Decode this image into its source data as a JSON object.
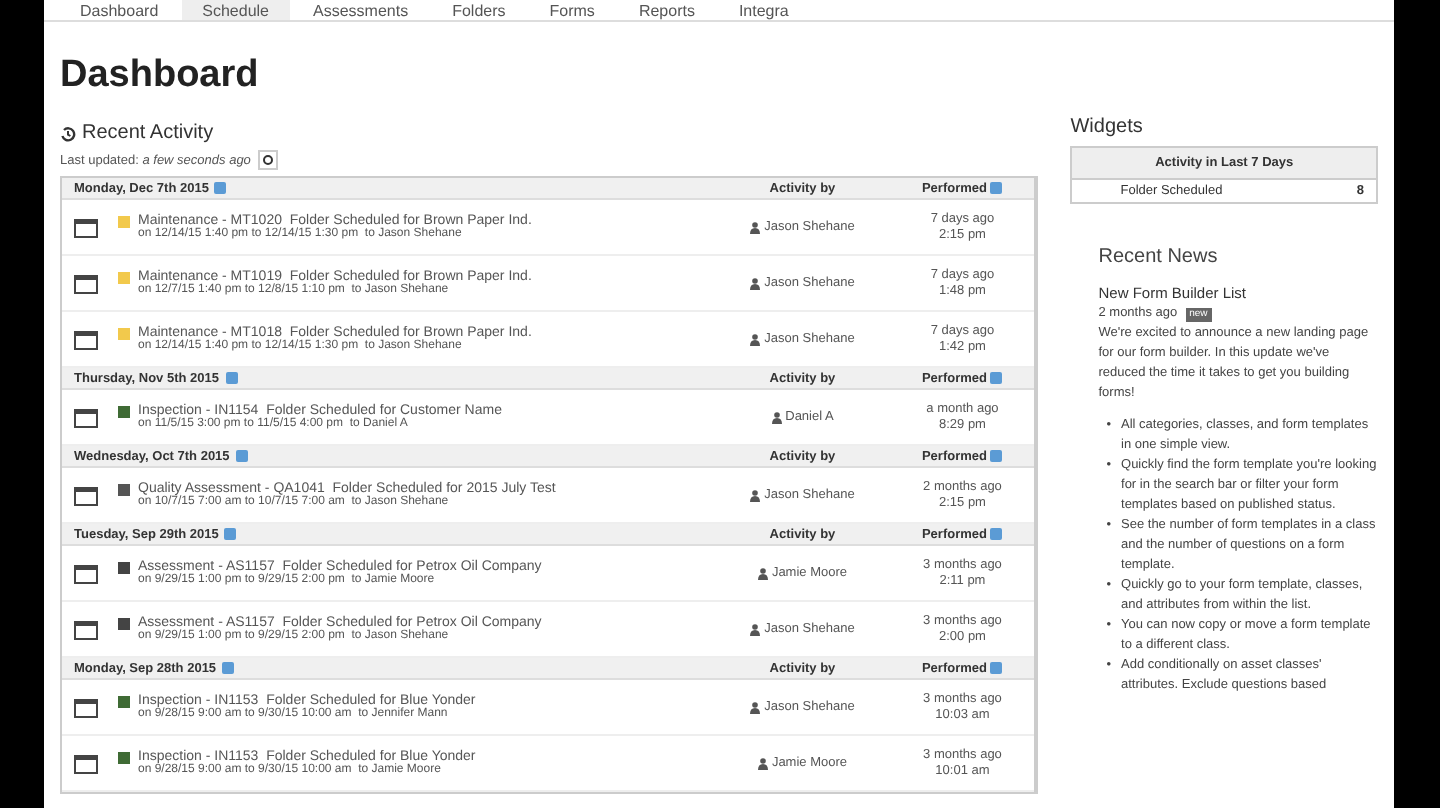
{
  "nav": [
    {
      "label": "Dashboard",
      "selected": false
    },
    {
      "label": "Schedule",
      "selected": true
    },
    {
      "label": "Assessments",
      "selected": false
    },
    {
      "label": "Folders",
      "selected": false
    },
    {
      "label": "Forms",
      "selected": false
    },
    {
      "label": "Reports",
      "selected": false
    },
    {
      "label": "Integra",
      "selected": false
    }
  ],
  "title": "Dashboard",
  "activity": {
    "title": "Recent Activity",
    "updated_label": "Last updated:",
    "updated_value": "a few seconds ago",
    "groups": [
      {
        "date": "Monday, Dec 7th 2015",
        "activity_by": "Activity by",
        "performed": "Performed",
        "rows": [
          {
            "color": "#f2c94c",
            "title": "Maintenance - MT1020  Folder Scheduled for Brown Paper Ind.",
            "detail": "on 12/14/15 1:40 pm to 12/14/15 1:30 pm  to Jason Shehane",
            "by": "Jason Shehane",
            "ago": "7 days ago",
            "time": "2:15 pm"
          },
          {
            "color": "#f2c94c",
            "title": "Maintenance - MT1019  Folder Scheduled for Brown Paper Ind.",
            "detail": "on 12/7/15 1:40 pm to 12/8/15 1:10 pm  to Jason Shehane",
            "by": "Jason Shehane",
            "ago": "7 days ago",
            "time": "1:48 pm"
          },
          {
            "color": "#f2c94c",
            "title": "Maintenance - MT1018  Folder Scheduled for Brown Paper Ind.",
            "detail": "on 12/14/15 1:40 pm to 12/14/15 1:30 pm  to Jason Shehane",
            "by": "Jason Shehane",
            "ago": "7 days ago",
            "time": "1:42 pm"
          }
        ]
      },
      {
        "date": "Thursday, Nov 5th 2015",
        "activity_by": "Activity by",
        "performed": "Performed",
        "rows": [
          {
            "color": "#3f6b35",
            "title": "Inspection - IN1154  Folder Scheduled for Customer Name",
            "detail": "on 11/5/15 3:00 pm to 11/5/15 4:00 pm  to Daniel A",
            "by": "Daniel A",
            "ago": "a month ago",
            "time": "8:29 pm"
          }
        ]
      },
      {
        "date": "Wednesday, Oct 7th 2015",
        "activity_by": "Activity by",
        "performed": "Performed",
        "rows": [
          {
            "color": "#555555",
            "title": "Quality Assessment - QA1041  Folder Scheduled for 2015 July Test",
            "detail": "on 10/7/15 7:00 am to 10/7/15 7:00 am  to Jason Shehane",
            "by": "Jason Shehane",
            "ago": "2 months ago",
            "time": "2:15 pm"
          }
        ]
      },
      {
        "date": "Tuesday, Sep 29th 2015",
        "activity_by": "Activity by",
        "performed": "Performed",
        "rows": [
          {
            "color": "#444444",
            "title": "Assessment - AS1157  Folder Scheduled for Petrox Oil Company",
            "detail": "on 9/29/15 1:00 pm to 9/29/15 2:00 pm  to Jamie Moore",
            "by": "Jamie Moore",
            "ago": "3 months ago",
            "time": "2:11 pm"
          },
          {
            "color": "#444444",
            "title": "Assessment - AS1157  Folder Scheduled for Petrox Oil Company",
            "detail": "on 9/29/15 1:00 pm to 9/29/15 2:00 pm  to Jason Shehane",
            "by": "Jason Shehane",
            "ago": "3 months ago",
            "time": "2:00 pm"
          }
        ]
      },
      {
        "date": "Monday, Sep 28th 2015",
        "activity_by": "Activity by",
        "performed": "Performed",
        "rows": [
          {
            "color": "#3f6b35",
            "title": "Inspection - IN1153  Folder Scheduled for Blue Yonder",
            "detail": "on 9/28/15 9:00 am to 9/30/15 10:00 am  to Jennifer Mann",
            "by": "Jason Shehane",
            "ago": "3 months ago",
            "time": "10:03 am"
          },
          {
            "color": "#3f6b35",
            "title": "Inspection - IN1153  Folder Scheduled for Blue Yonder",
            "detail": "on 9/28/15 9:00 am to 9/30/15 10:00 am  to Jamie Moore",
            "by": "Jamie Moore",
            "ago": "3 months ago",
            "time": "10:01 am"
          }
        ]
      }
    ]
  },
  "widgets": {
    "title": "Widgets",
    "table_title": "Activity in Last 7 Days",
    "rows": [
      {
        "label": "Folder Scheduled",
        "count": "8"
      }
    ]
  },
  "news": {
    "title": "Recent News",
    "item_title": "New Form Builder List",
    "item_date": "2 months ago",
    "badge": "new",
    "intro": "We're excited to announce a new landing page for our form builder. In this update we've reduced the time it takes to get you building forms!",
    "bullets": [
      {
        "marker": "•",
        "text": "All categories, classes, and form templates in one simple view."
      },
      {
        "marker": "•",
        "text": "Quickly find the form template you're looking for in the search bar or filter your form templates based on published status."
      },
      {
        "marker": "•",
        "text": "See the number of form templates in a class and the number of questions on a form template."
      },
      {
        "marker": "•",
        "text": "Quickly go to your form template, classes, and attributes from within the list."
      },
      {
        "marker": "•",
        "text": "You can now copy or move a form template to a different class."
      },
      {
        "marker": "•",
        "text": "Add conditionally on asset classes' attributes. Exclude questions based"
      }
    ]
  }
}
